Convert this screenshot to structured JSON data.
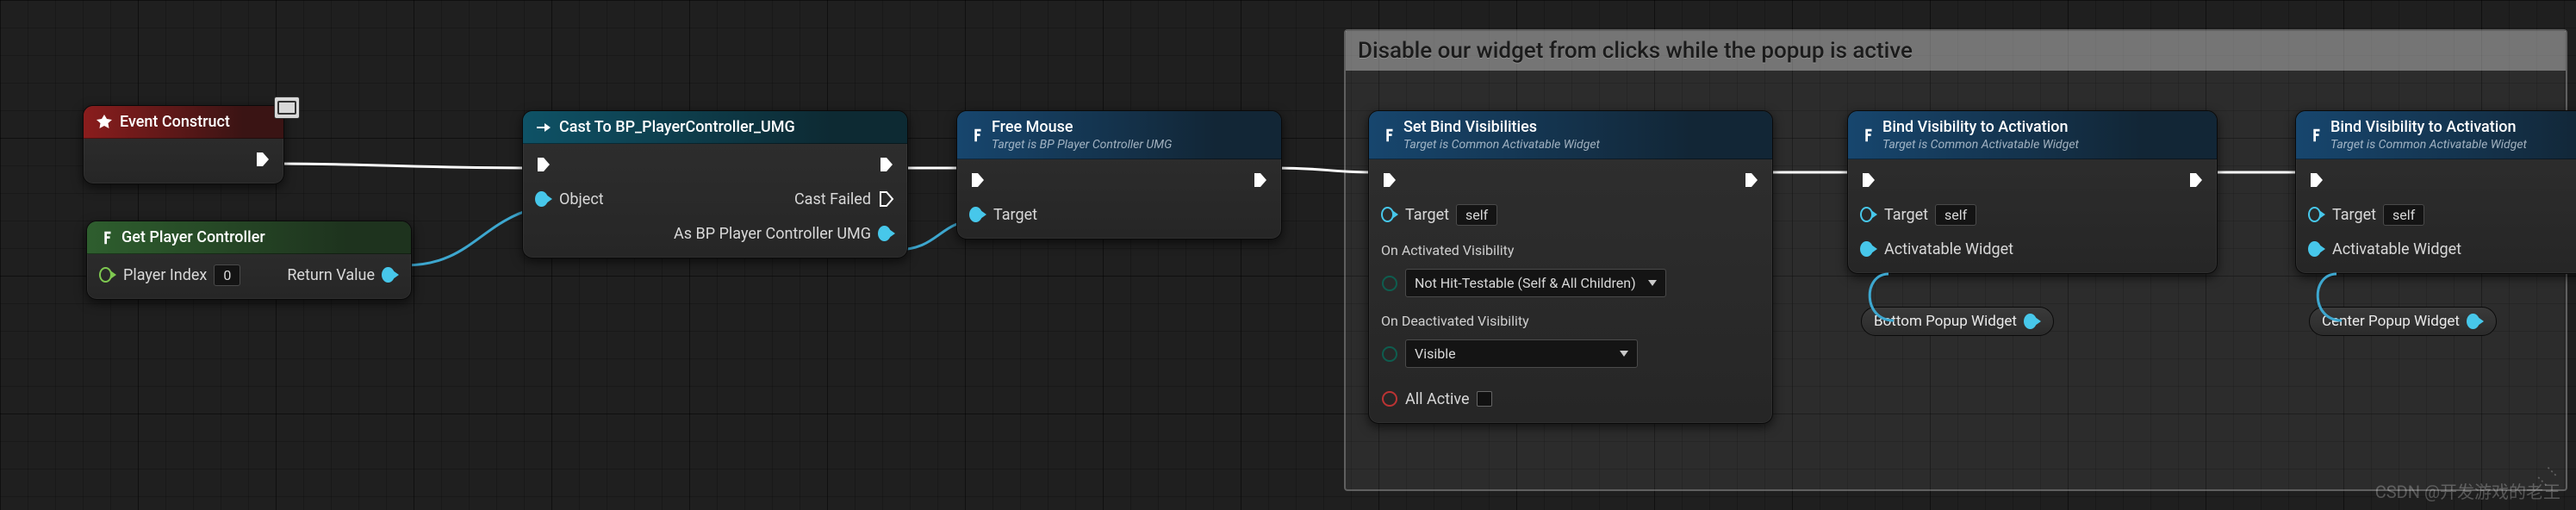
{
  "comment": {
    "title": "Disable our widget from clicks while the popup is active"
  },
  "nodes": {
    "eventConstruct": {
      "title": "Event Construct"
    },
    "getPC": {
      "title": "Get Player Controller",
      "playerIndexLabel": "Player Index",
      "playerIndexValue": "0",
      "returnLabel": "Return Value"
    },
    "cast": {
      "title": "Cast To BP_PlayerController_UMG",
      "objectLabel": "Object",
      "castFailedLabel": "Cast Failed",
      "asLabel": "As BP Player Controller UMG"
    },
    "freeMouse": {
      "title": "Free Mouse",
      "subtitle": "Target is BP Player Controller UMG",
      "targetLabel": "Target"
    },
    "setBind": {
      "title": "Set Bind Visibilities",
      "subtitle": "Target is Common Activatable Widget",
      "targetLabel": "Target",
      "targetValue": "self",
      "onActLabel": "On Activated Visibility",
      "onActValue": "Not Hit-Testable (Self & All Children)",
      "onDeactLabel": "On Deactivated Visibility",
      "onDeactValue": "Visible",
      "allActiveLabel": "All Active"
    },
    "bind1": {
      "title": "Bind Visibility to Activation",
      "subtitle": "Target is Common Activatable Widget",
      "targetLabel": "Target",
      "targetValue": "self",
      "activatableLabel": "Activatable Widget",
      "pill": "Bottom Popup Widget"
    },
    "bind2": {
      "title": "Bind Visibility to Activation",
      "subtitle": "Target is Common Activatable Widget",
      "targetLabel": "Target",
      "targetValue": "self",
      "activatableLabel": "Activatable Widget",
      "pill": "Center Popup Widget"
    }
  },
  "watermark": "CSDN @开发游戏的老王"
}
